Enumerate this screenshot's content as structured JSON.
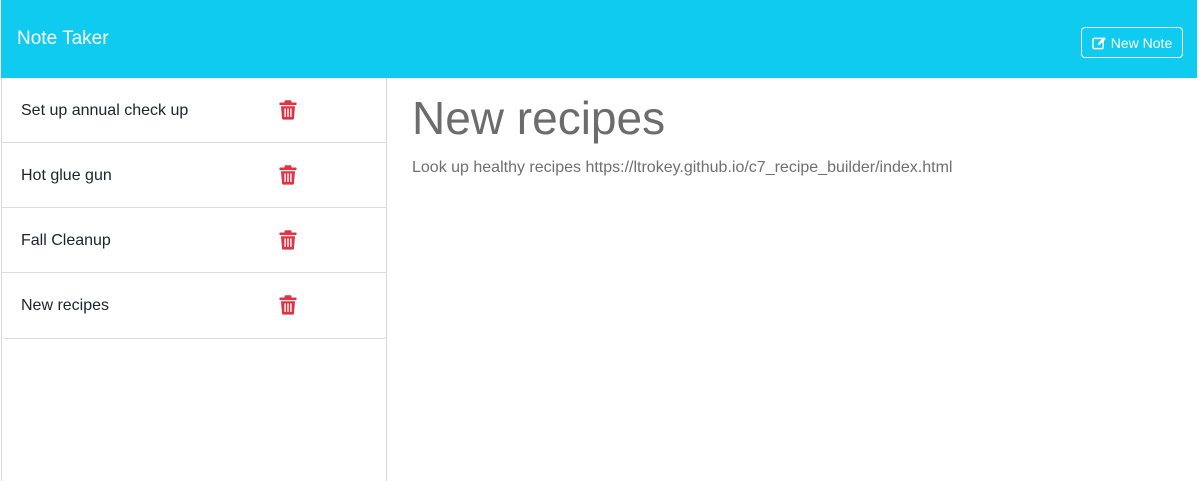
{
  "app": {
    "title": "Note Taker"
  },
  "header": {
    "new_note_label": "New Note",
    "accent_color": "#10cbf0"
  },
  "sidebar": {
    "notes": [
      {
        "title": "Set up annual check up"
      },
      {
        "title": "Hot glue gun"
      },
      {
        "title": "Fall Cleanup"
      },
      {
        "title": "New recipes"
      }
    ],
    "delete_icon": "trash-icon",
    "delete_color": "#dc3545"
  },
  "main": {
    "note_title": "New recipes",
    "note_text": "Look up healthy recipes https://ltrokey.github.io/c7_recipe_builder/index.html"
  }
}
